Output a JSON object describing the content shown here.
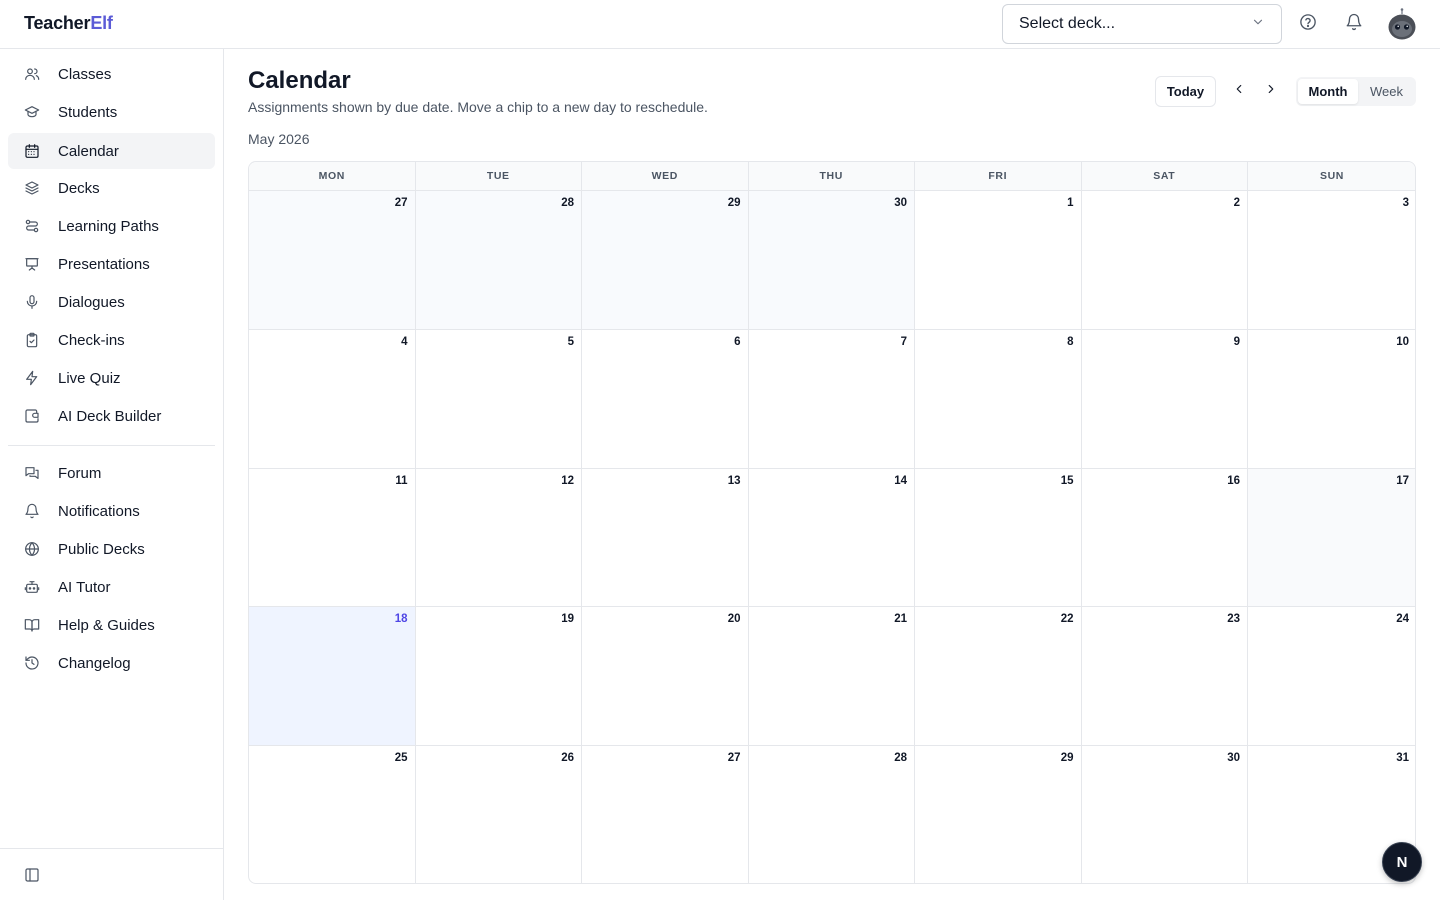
{
  "brand": {
    "part1": "Teacher",
    "part2": "Elf"
  },
  "deck_select": {
    "value": "Select deck..."
  },
  "sidebar": {
    "primary": [
      {
        "label": "Classes",
        "icon": "users-icon"
      },
      {
        "label": "Students",
        "icon": "graduation-cap-icon"
      },
      {
        "label": "Calendar",
        "icon": "calendar-icon",
        "active": true
      },
      {
        "label": "Decks",
        "icon": "layers-icon"
      },
      {
        "label": "Learning Paths",
        "icon": "route-icon"
      },
      {
        "label": "Presentations",
        "icon": "presentation-icon"
      },
      {
        "label": "Dialogues",
        "icon": "mic-icon"
      },
      {
        "label": "Check-ins",
        "icon": "clipboard-check-icon"
      },
      {
        "label": "Live Quiz",
        "icon": "zap-icon"
      },
      {
        "label": "AI Deck Builder",
        "icon": "wallet-icon"
      }
    ],
    "secondary": [
      {
        "label": "Forum",
        "icon": "messages-icon"
      },
      {
        "label": "Notifications",
        "icon": "bell-icon"
      },
      {
        "label": "Public Decks",
        "icon": "globe-icon"
      },
      {
        "label": "AI Tutor",
        "icon": "bot-icon"
      },
      {
        "label": "Help & Guides",
        "icon": "book-icon"
      },
      {
        "label": "Changelog",
        "icon": "history-icon"
      }
    ]
  },
  "header": {
    "title": "Calendar",
    "subtitle": "Assignments shown by due date. Move a chip to a new day to reschedule.",
    "month_label": "May 2026",
    "today_label": "Today",
    "view_options": [
      "Month",
      "Week"
    ],
    "active_view": "Month"
  },
  "calendar": {
    "weekdays": [
      "MON",
      "TUE",
      "WED",
      "THU",
      "FRI",
      "SAT",
      "SUN"
    ],
    "weeks": [
      [
        "27",
        "28",
        "29",
        "30",
        "1",
        "2",
        "3"
      ],
      [
        "4",
        "5",
        "6",
        "7",
        "8",
        "9",
        "10"
      ],
      [
        "11",
        "12",
        "13",
        "14",
        "15",
        "16",
        "17"
      ],
      [
        "18",
        "19",
        "20",
        "21",
        "22",
        "23",
        "24"
      ],
      [
        "25",
        "26",
        "27",
        "28",
        "29",
        "30",
        "31"
      ]
    ],
    "today": "18",
    "accent_color": "#4f46e5"
  },
  "fab": {
    "label": "N"
  }
}
